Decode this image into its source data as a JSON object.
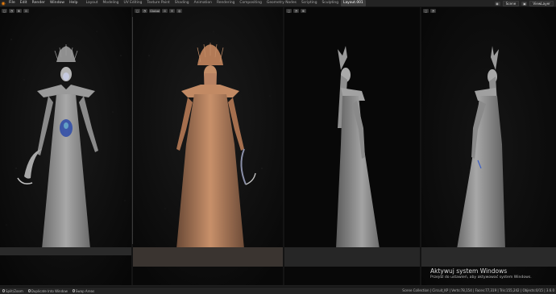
{
  "menu": [
    "File",
    "Edit",
    "Render",
    "Window",
    "Help"
  ],
  "workspaces": [
    "Layout",
    "Modeling",
    "UV Editing",
    "Texture Paint",
    "Shading",
    "Animation",
    "Rendering",
    "Compositing",
    "Geometry Nodes",
    "Scripting",
    "Sculpting",
    "Layout.001"
  ],
  "active_workspace": "Layout.001",
  "scene_field": "Scene",
  "viewlayer_field": "ViewLayer",
  "viewport_header": {
    "mode_label": "Global",
    "icons": [
      "object-mode-icon",
      "view-icon",
      "transform-orientation-icon",
      "pivot-icon",
      "snap-icon",
      "proportional-icon"
    ]
  },
  "watermark": {
    "title": "Aktywuj system Windows",
    "subtitle": "Przejdź do ustawień, aby aktywować system Windows."
  },
  "statusbar": {
    "items": [
      "Split/Zoom",
      "Duplicate Into Window",
      "Swap Areas"
    ],
    "stats": "Scene Collection | Circuit_KP | Verts:78,154 | Faces:77,319 | Tris:155,242 | Objects:0/15 | 3.6.0"
  },
  "colors": {
    "accent": "#e87d0d",
    "figure_gray": "#9a9a9a",
    "figure_copper": "#c58a62",
    "crystal_blue": "#3b5fc4"
  }
}
